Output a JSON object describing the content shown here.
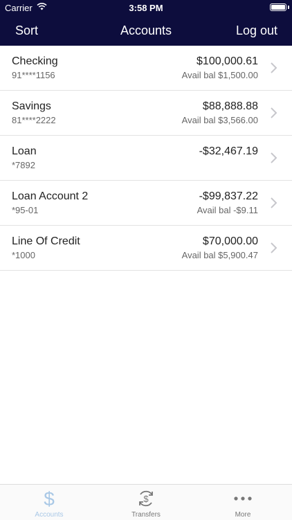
{
  "status_bar": {
    "carrier": "Carrier",
    "time": "3:58 PM"
  },
  "nav": {
    "left": "Sort",
    "title": "Accounts",
    "right": "Log out"
  },
  "accounts": [
    {
      "name": "Checking",
      "number": "91****1156",
      "balance": "$100,000.61",
      "available": "Avail bal $1,500.00"
    },
    {
      "name": "Savings",
      "number": "81****2222",
      "balance": "$88,888.88",
      "available": "Avail bal $3,566.00"
    },
    {
      "name": "Loan",
      "number": "*7892",
      "balance": "-$32,467.19",
      "available": ""
    },
    {
      "name": "Loan Account 2",
      "number": "*95-01",
      "balance": "-$99,837.22",
      "available": "Avail bal -$9.11"
    },
    {
      "name": "Line Of Credit",
      "number": "*1000",
      "balance": "$70,000.00",
      "available": "Avail bal $5,900.47"
    }
  ],
  "tabs": [
    {
      "label": "Accounts",
      "icon": "dollar-icon",
      "active": true
    },
    {
      "label": "Transfers",
      "icon": "transfer-dollar-icon",
      "active": false
    },
    {
      "label": "More",
      "icon": "more-dots-icon",
      "active": false
    }
  ],
  "colors": {
    "header_bg": "#0d0d3d",
    "active_tab": "#a9c8e6",
    "inactive_tab": "#777777",
    "chevron": "#c7c7cc"
  }
}
